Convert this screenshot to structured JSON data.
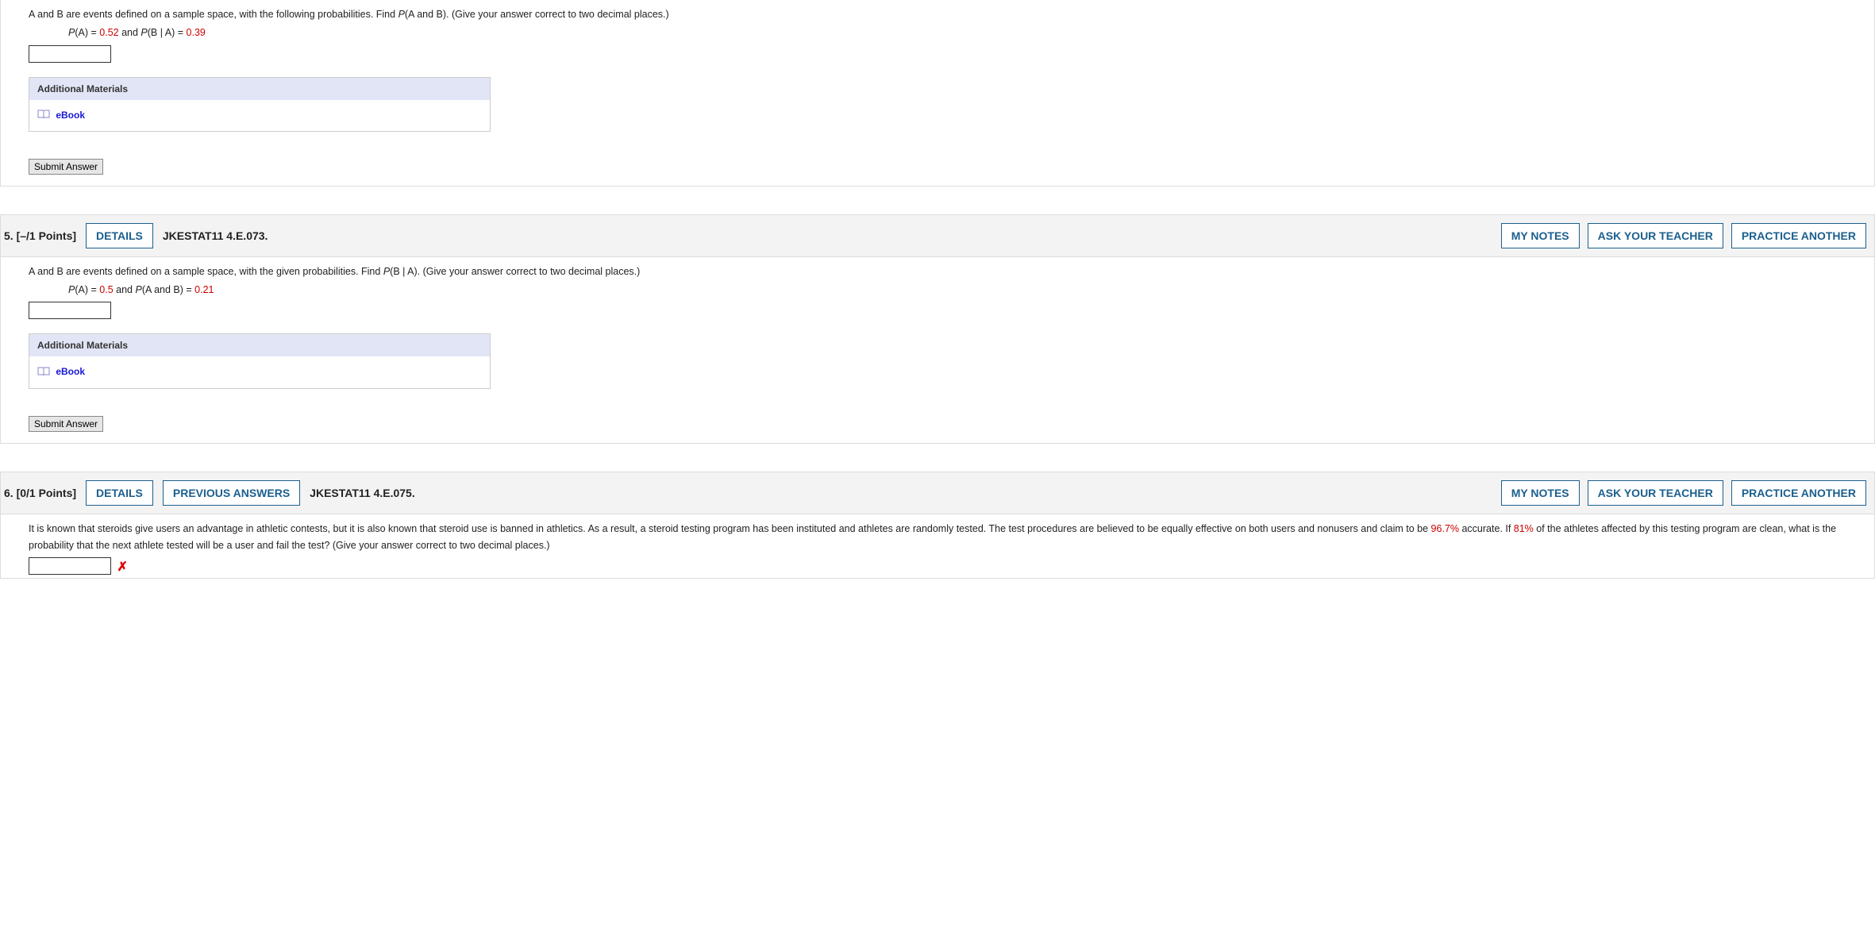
{
  "q4": {
    "prompt_prefix": "A and B are events defined on a sample space, with the following probabilities. Find ",
    "prompt_target": "P",
    "prompt_target2": "(A and B). (Give your answer correct to two decimal places.)",
    "eq_p1": "P",
    "eq_p2": "(A) = ",
    "eq_v1": "0.52",
    "eq_mid": " and ",
    "eq_p3": "P",
    "eq_p4": "(B | A) = ",
    "eq_v2": "0.39",
    "materials_hdr": "Additional Materials",
    "ebook": "eBook",
    "submit": "Submit Answer"
  },
  "q5": {
    "num_pts": "5.  [–/1 Points]",
    "details": "DETAILS",
    "ref": "JKESTAT11 4.E.073.",
    "mynotes": "MY NOTES",
    "ask": "ASK YOUR TEACHER",
    "practice": "PRACTICE ANOTHER",
    "prompt_prefix": "A and B are events defined on a sample space, with the given probabilities. Find ",
    "prompt_target": "P",
    "prompt_target2": "(B | A). (Give your answer correct to two decimal places.)",
    "eq_p1": "P",
    "eq_p2": "(A) = ",
    "eq_v1": "0.5",
    "eq_mid": " and ",
    "eq_p3": "P",
    "eq_p4": "(A and B) = ",
    "eq_v2": "0.21",
    "materials_hdr": "Additional Materials",
    "ebook": "eBook",
    "submit": "Submit Answer"
  },
  "q6": {
    "num_pts": "6.  [0/1 Points]",
    "details": "DETAILS",
    "prev": "PREVIOUS ANSWERS",
    "ref": "JKESTAT11 4.E.075.",
    "mynotes": "MY NOTES",
    "ask": "ASK YOUR TEACHER",
    "practice": "PRACTICE ANOTHER",
    "p1": "It is known that steroids give users an advantage in athletic contests, but it is also known that steroid use is banned in athletics. As a result, a steroid testing program has been instituted and athletes are randomly tested. The test procedures are believed to be equally effective on both users and nonusers and claim to be ",
    "v1": "96.7%",
    "p2": " accurate. If ",
    "v2": "81%",
    "p3": " of the athletes affected by this testing program are clean, what is the probability that the next athlete tested will be a user and fail the test? (Give your answer correct to two decimal places.)"
  }
}
